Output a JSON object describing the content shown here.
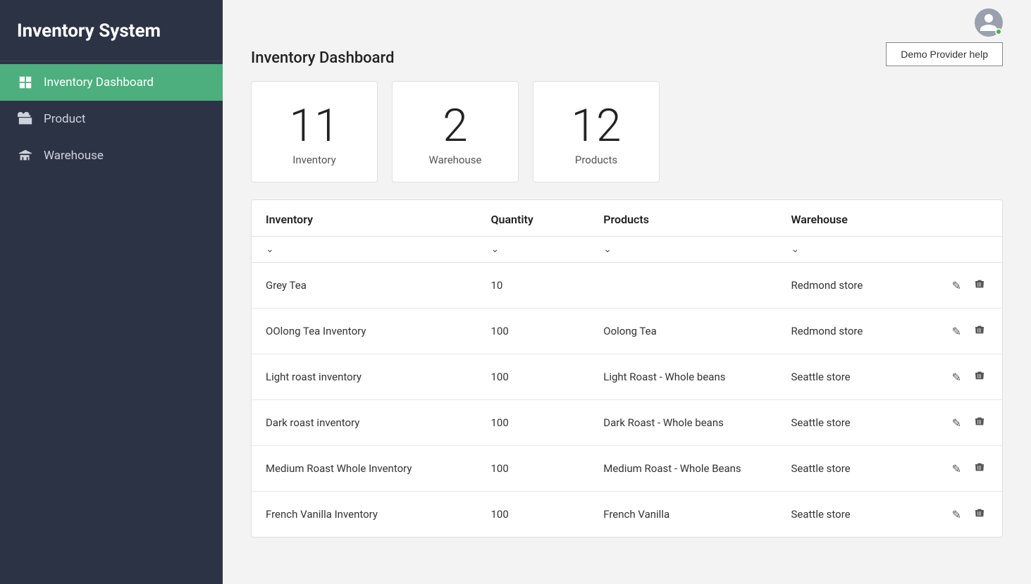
{
  "sidebar": {
    "title": "Inventory System",
    "nav": [
      {
        "id": "inventory-dashboard",
        "label": "Inventory Dashboard",
        "icon": "dashboard-icon",
        "active": true
      },
      {
        "id": "product",
        "label": "Product",
        "icon": "product-icon",
        "active": false
      },
      {
        "id": "warehouse",
        "label": "Warehouse",
        "icon": "warehouse-icon",
        "active": false
      }
    ]
  },
  "header": {
    "page_title": "Inventory Dashboard",
    "help_button_label": "Demo Provider help"
  },
  "stats": [
    {
      "number": "11",
      "label": "Inventory"
    },
    {
      "number": "2",
      "label": "Warehouse"
    },
    {
      "number": "12",
      "label": "Products"
    }
  ],
  "table": {
    "columns": [
      {
        "key": "inventory",
        "label": "Inventory"
      },
      {
        "key": "quantity",
        "label": "Quantity"
      },
      {
        "key": "products",
        "label": "Products"
      },
      {
        "key": "warehouse",
        "label": "Warehouse"
      }
    ],
    "rows": [
      {
        "inventory": "Grey Tea",
        "quantity": "10",
        "products": "",
        "warehouse": "Redmond store"
      },
      {
        "inventory": "OOlong Tea Inventory",
        "quantity": "100",
        "products": "Oolong Tea",
        "warehouse": "Redmond store"
      },
      {
        "inventory": "Light roast inventory",
        "quantity": "100",
        "products": "Light Roast - Whole beans",
        "warehouse": "Seattle store"
      },
      {
        "inventory": "Dark roast inventory",
        "quantity": "100",
        "products": "Dark Roast - Whole beans",
        "warehouse": "Seattle store"
      },
      {
        "inventory": "Medium Roast Whole Inventory",
        "quantity": "100",
        "products": "Medium Roast - Whole Beans",
        "warehouse": "Seattle store"
      },
      {
        "inventory": "French Vanilla Inventory",
        "quantity": "100",
        "products": "French Vanilla",
        "warehouse": "Seattle store"
      }
    ]
  }
}
